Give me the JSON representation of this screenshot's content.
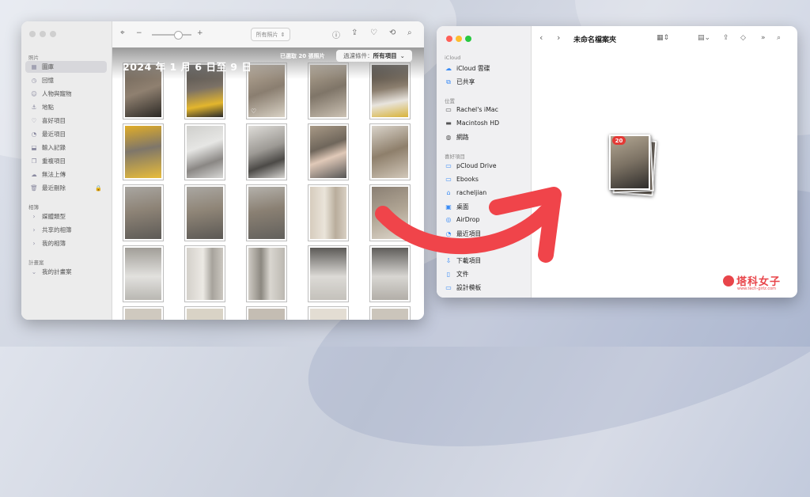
{
  "photos_window": {
    "sidebar": {
      "photos_section": "照片",
      "items": [
        {
          "label": "圖庫",
          "icon": "photo-library-icon",
          "selected": true
        },
        {
          "label": "回憶",
          "icon": "memories-icon"
        },
        {
          "label": "人物與寵物",
          "icon": "people-icon"
        },
        {
          "label": "地點",
          "icon": "places-icon"
        },
        {
          "label": "喜好項目",
          "icon": "heart-icon"
        },
        {
          "label": "最近項目",
          "icon": "clock-icon"
        },
        {
          "label": "輸入記錄",
          "icon": "import-icon"
        },
        {
          "label": "重複項目",
          "icon": "duplicates-icon"
        },
        {
          "label": "無法上傳",
          "icon": "cloud-icon"
        },
        {
          "label": "最近刪除",
          "icon": "trash-icon"
        }
      ],
      "albums_section": "相簿",
      "albums": [
        {
          "label": "媒體類型"
        },
        {
          "label": "共享的相簿"
        },
        {
          "label": "我的相簿"
        }
      ],
      "projects_section": "計畫案",
      "projects": [
        {
          "label": "我的計畫案"
        }
      ]
    },
    "toolbar": {
      "zoom_minus": "−",
      "zoom_plus": "+",
      "view_filter": "所有照片"
    },
    "grid": {
      "date_title": "2024 年 1 月 6 日至 9 日",
      "selection_count": "已選取 20 張照片",
      "filter_prefix": "過濾條件：",
      "filter_value": "所有項目"
    }
  },
  "finder_window": {
    "title": "未命名檔案夾",
    "sidebar": {
      "icloud_section": "iCloud",
      "icloud_items": [
        {
          "label": "iCloud 雲碟",
          "icon": "cloud-icon"
        },
        {
          "label": "已共享",
          "icon": "shared-folder-icon"
        }
      ],
      "locations_section": "位置",
      "location_items": [
        {
          "label": "Rachel's iMac",
          "icon": "imac-icon"
        },
        {
          "label": "Macintosh HD",
          "icon": "disk-icon"
        },
        {
          "label": "網路",
          "icon": "globe-icon"
        }
      ],
      "favorites_section": "喜好項目",
      "favorite_items": [
        {
          "label": "pCloud Drive",
          "icon": "folder-icon"
        },
        {
          "label": "Ebooks",
          "icon": "folder-icon"
        },
        {
          "label": "racheljian",
          "icon": "home-icon"
        },
        {
          "label": "桌面",
          "icon": "desktop-icon"
        },
        {
          "label": "AirDrop",
          "icon": "airdrop-icon"
        },
        {
          "label": "最近項目",
          "icon": "clock-icon"
        },
        {
          "label": "下載項目",
          "icon": "download-icon"
        },
        {
          "label": "文件",
          "icon": "document-icon"
        },
        {
          "label": "設計模板",
          "icon": "folder-icon"
        }
      ]
    },
    "drag_badge": "20"
  },
  "watermark": {
    "name": "塔科女子",
    "url": "www.tech-girlz.com"
  },
  "colors": {
    "arrow": "#f0444a",
    "accent": "#3b8cf5",
    "badge": "#e53935"
  }
}
